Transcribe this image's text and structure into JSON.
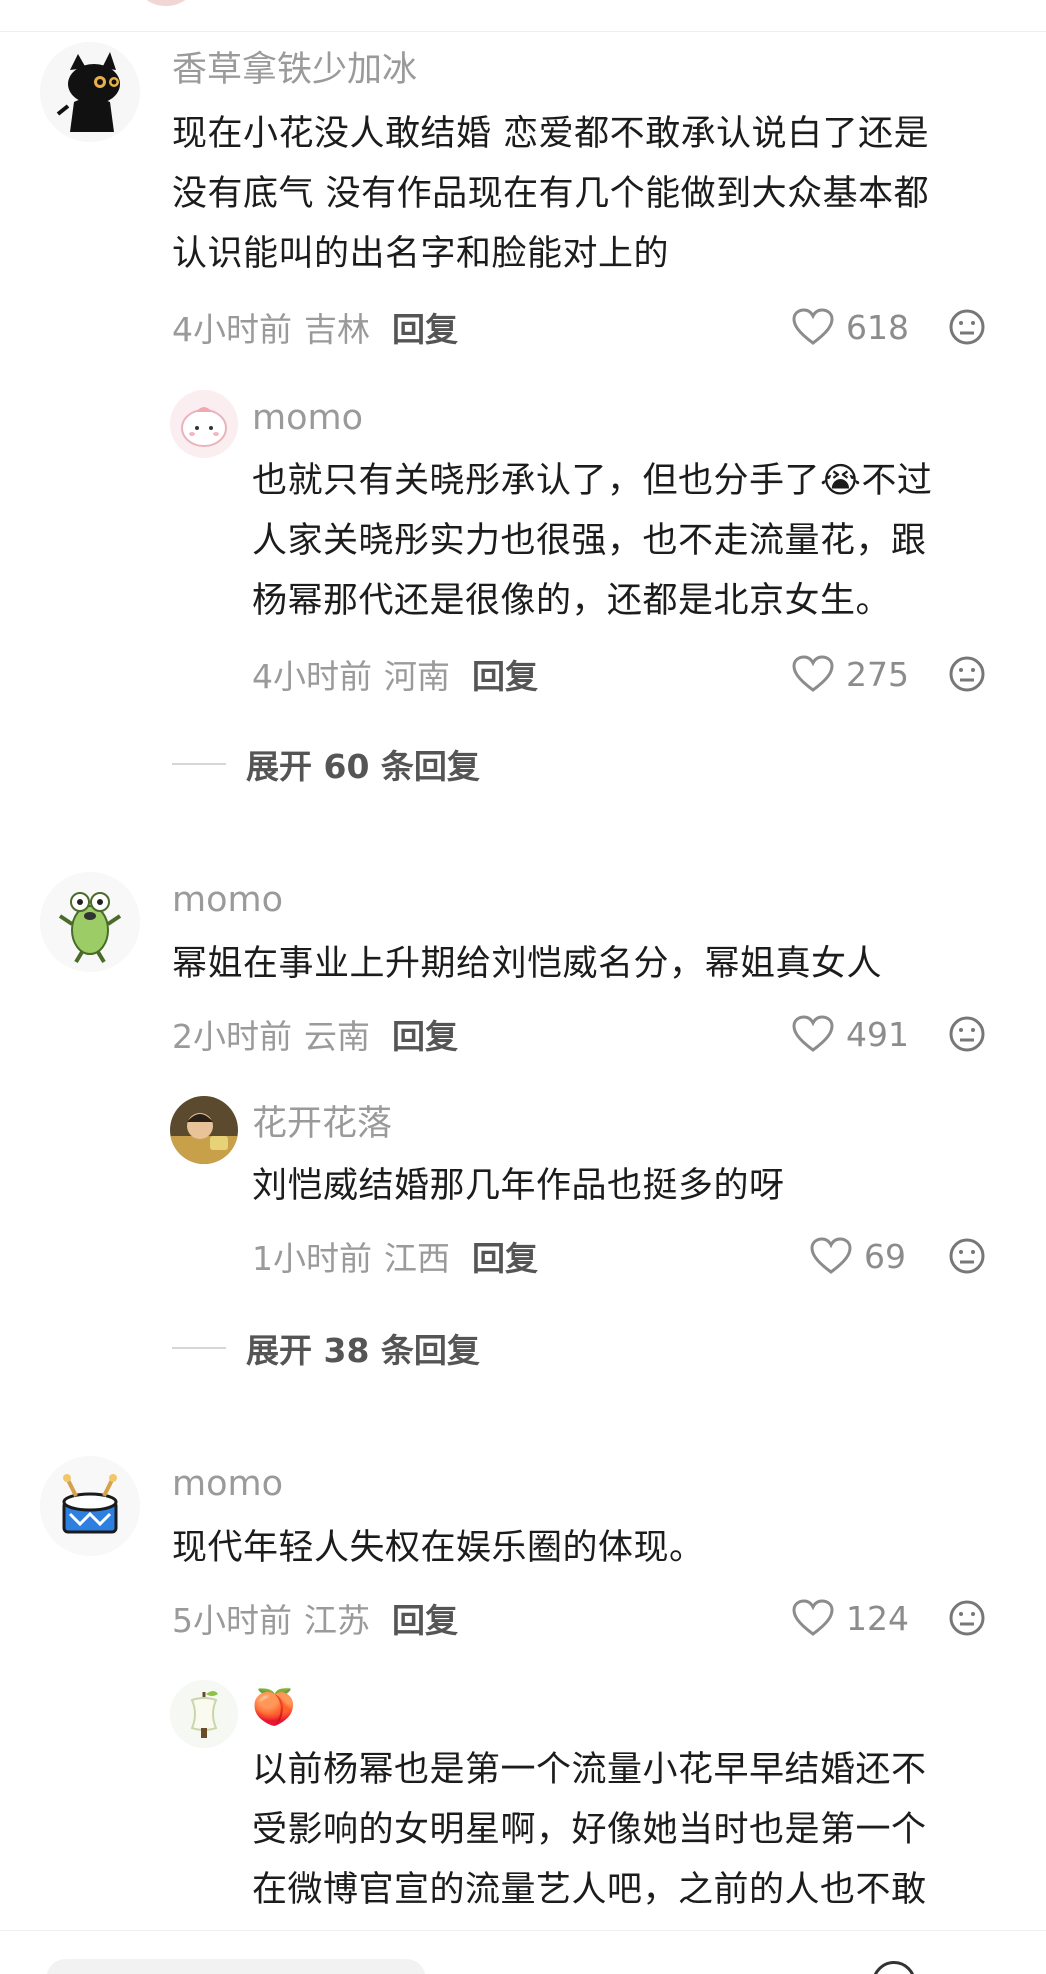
{
  "comments": [
    {
      "username": "香草拿铁少加冰",
      "avatar_icon": "black-cat-avatar-icon",
      "text_lines": [
        "现在小花没人敢结婚 恋爱都不敢承认说白了还是",
        "没有底气 没有作品现在有几个能做到大众基本都",
        "认识能叫的出名字和脸能对上的"
      ],
      "time": "4小时前",
      "location": "吉林",
      "reply_label": "回复",
      "likes": "618",
      "replies": [
        {
          "username": "momo",
          "avatar_icon": "pink-bun-avatar-icon",
          "text_lines": [
            "也就只有关晓彤承认了，但也分手了😭不过",
            "人家关晓彤实力也很强，也不走流量花，跟",
            "杨幂那代还是很像的，还都是北京女生。"
          ],
          "time": "4小时前",
          "location": "河南",
          "reply_label": "回复",
          "likes": "275"
        }
      ],
      "expand_label": "展开 60 条回复"
    },
    {
      "username": "momo",
      "avatar_icon": "frog-avatar-icon",
      "text_lines": [
        "幂姐在事业上升期给刘恺威名分，幂姐真女人"
      ],
      "time": "2小时前",
      "location": "云南",
      "reply_label": "回复",
      "likes": "491",
      "replies": [
        {
          "username": "花开花落",
          "avatar_icon": "child-photo-avatar-icon",
          "text_lines": [
            "刘恺威结婚那几年作品也挺多的呀"
          ],
          "time": "1小时前",
          "location": "江西",
          "reply_label": "回复",
          "likes": "69"
        }
      ],
      "expand_label": "展开 38 条回复"
    },
    {
      "username": "momo",
      "avatar_icon": "drum-avatar-icon",
      "text_lines": [
        "现代年轻人失权在娱乐圈的体现。"
      ],
      "time": "5小时前",
      "location": "江苏",
      "reply_label": "回复",
      "likes": "124",
      "replies": [
        {
          "username": "🍑",
          "avatar_icon": "apple-core-avatar-icon",
          "text_lines": [
            "以前杨幂也是第一个流量小花早早结婚还不",
            "受影响的女明星啊，好像她当时也是第一个",
            "在微博官宣的流量艺人吧，之前的人也不敢"
          ]
        }
      ]
    }
  ]
}
